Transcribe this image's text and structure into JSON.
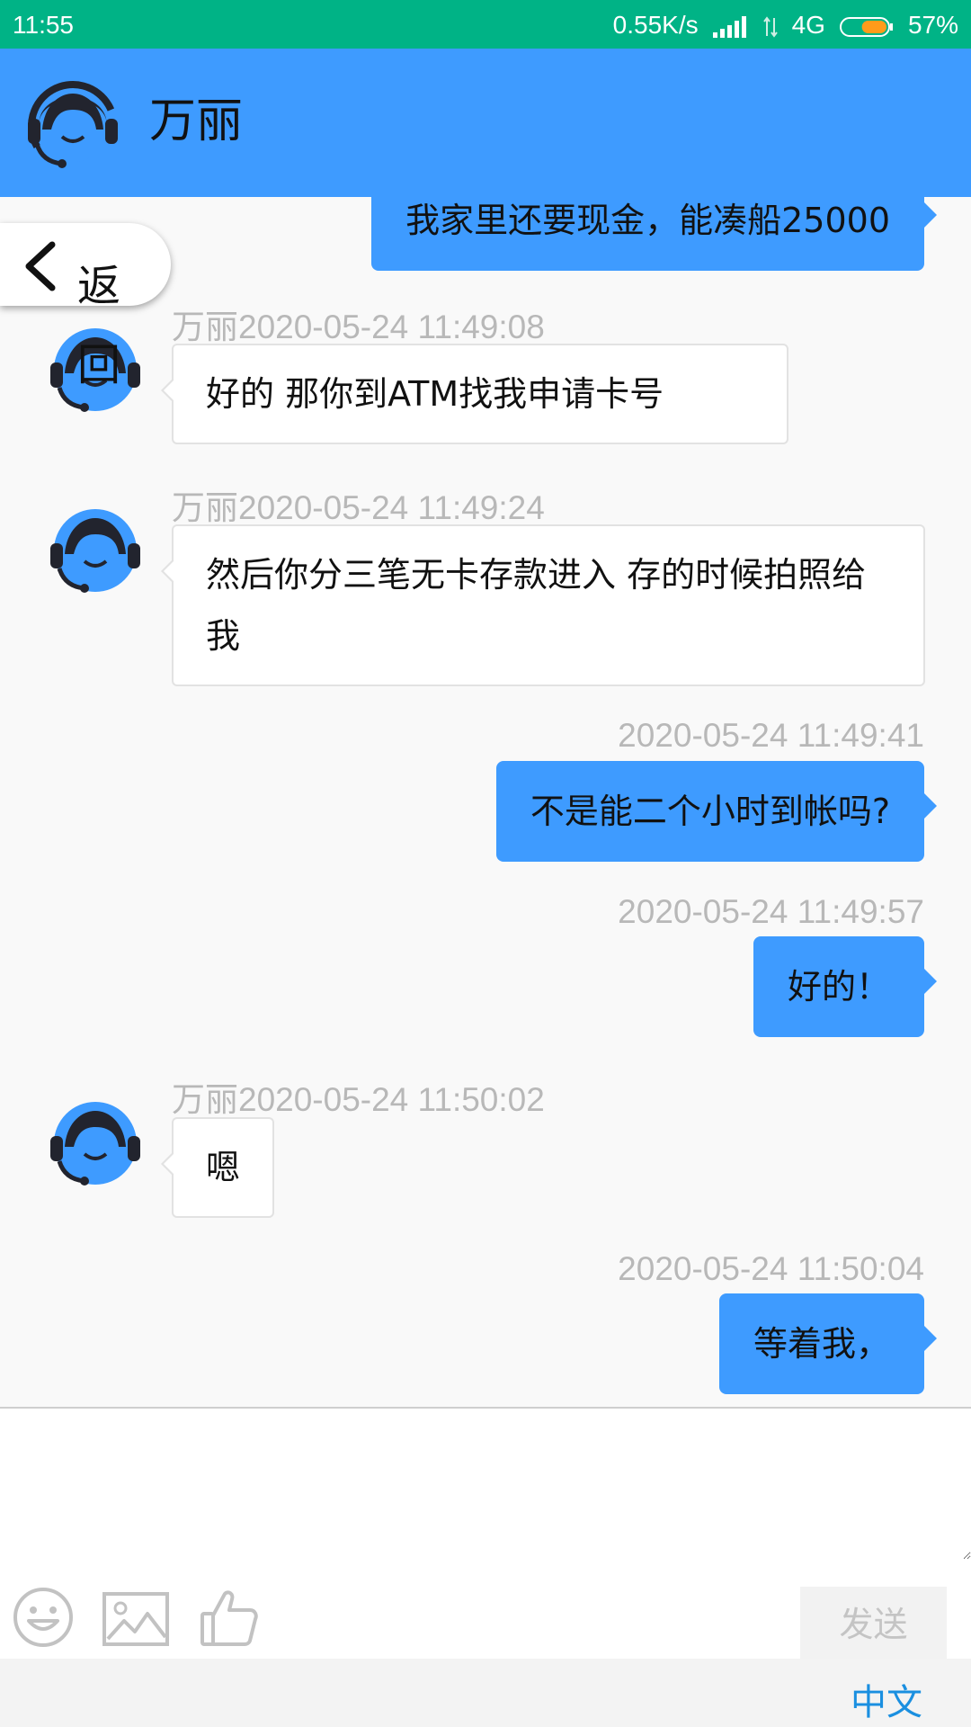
{
  "status_bar": {
    "time": "11:55",
    "net_speed": "0.55K/s",
    "network": "4G",
    "battery": "57%",
    "battery_level": 0.57,
    "bg_color": "#00b386"
  },
  "header": {
    "title": "万丽",
    "bg_color": "#3e9bff"
  },
  "back_button": {
    "label": "返回"
  },
  "messages": [
    {
      "sender": "me",
      "text": "我家里还要现金，能凑船25000"
    },
    {
      "sender": "other",
      "time": "万丽2020-05-24 11:49:08",
      "text": "好的  那你到ATM找我申请卡号"
    },
    {
      "sender": "other",
      "time": "万丽2020-05-24 11:49:24",
      "text": "然后你分三笔无卡存款进入  存的时候拍照给我"
    },
    {
      "sender": "me",
      "time": "2020-05-24 11:49:41",
      "text": "不是能二个小时到帐吗?"
    },
    {
      "sender": "me",
      "time": "2020-05-24 11:49:57",
      "text": "好的！"
    },
    {
      "sender": "other",
      "time": "万丽2020-05-24 11:50:02",
      "text": "嗯"
    },
    {
      "sender": "me",
      "time": "2020-05-24 11:50:04",
      "text": "等着我，"
    }
  ],
  "composer": {
    "input_value": "",
    "send_label": "发送",
    "icons": [
      "emoji-icon",
      "image-icon",
      "thumbs-up-icon"
    ]
  },
  "keyboard": {
    "language": "中文"
  },
  "colors": {
    "my_bubble": "#3e9bff",
    "other_bubble": "#ffffff",
    "timestamp": "#b8b8b8"
  }
}
